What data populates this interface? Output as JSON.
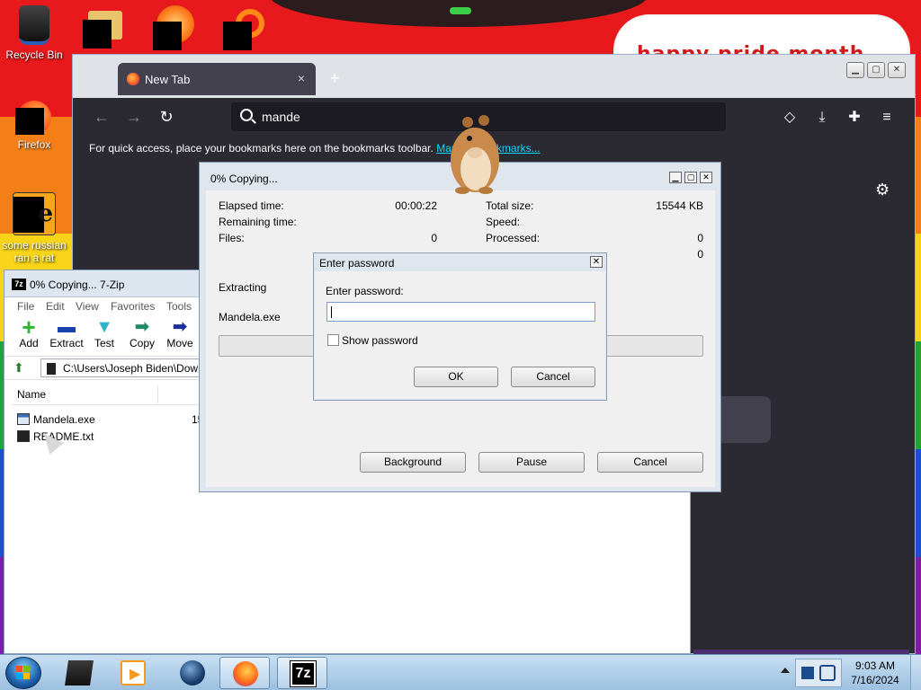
{
  "desktop": {
    "banner_text": "happy pride month",
    "icons": [
      {
        "label": "Recycle Bin"
      },
      {
        "label": "Firefox"
      },
      {
        "label": "some russian ran a rat"
      }
    ]
  },
  "firefox": {
    "tab_title": "New Tab",
    "tab_close": "×",
    "new_tab": "+",
    "search_text": "mande",
    "bookmarks_message": "For quick access, place your bookmarks here on the bookmarks toolbar. ",
    "bookmarks_link": "Manage bookmarks...",
    "icons": {
      "back": "←",
      "forward": "→",
      "reload": "↻",
      "pocket": "◇",
      "downloads": "⤓",
      "extensions": "✚",
      "menu": "≡",
      "settings": "⚙"
    }
  },
  "sevenzip": {
    "title": "0% Copying... 7-Zip",
    "app_icon_text": "7z",
    "menu": [
      "File",
      "Edit",
      "View",
      "Favorites",
      "Tools"
    ],
    "toolbar": [
      {
        "label": "Add",
        "glyph": "+",
        "color": "#2fb52f"
      },
      {
        "label": "Extract",
        "glyph": "▬",
        "color": "#1b3fa8"
      },
      {
        "label": "Test",
        "glyph": "▼",
        "color": "#2fb5c9"
      },
      {
        "label": "Copy",
        "glyph": "➡",
        "color": "#1e8a6a"
      },
      {
        "label": "Move",
        "glyph": "➡",
        "color": "#1b2f9a"
      }
    ],
    "path": "C:\\Users\\Joseph Biden\\Down",
    "column_name": "Name",
    "files": [
      {
        "name": "Mandela.exe",
        "size": "15"
      },
      {
        "name": "README.txt",
        "size": ""
      }
    ]
  },
  "copy_dialog": {
    "title": "0% Copying...",
    "elapsed_label": "Elapsed time:",
    "elapsed_value": "00:00:22",
    "remaining_label": "Remaining time:",
    "files_label": "Files:",
    "files_value": "0",
    "total_size_label": "Total size:",
    "total_size_value": "15544 KB",
    "speed_label": "Speed:",
    "processed_label": "Processed:",
    "processed_value": "0",
    "extra_value": "0",
    "action": "Extracting",
    "current_file": "Mandela.exe",
    "progress": 0,
    "buttons": {
      "background": "Background",
      "pause": "Pause",
      "cancel": "Cancel"
    }
  },
  "password_dialog": {
    "title": "Enter password",
    "close": "✕",
    "label": "Enter password:",
    "value": "",
    "show_password_label": "Show password",
    "show_password_checked": false,
    "ok": "OK",
    "cancel": "Cancel"
  },
  "taskbar": {
    "time": "9:03 AM",
    "date": "7/16/2024",
    "active_app": "7z"
  }
}
